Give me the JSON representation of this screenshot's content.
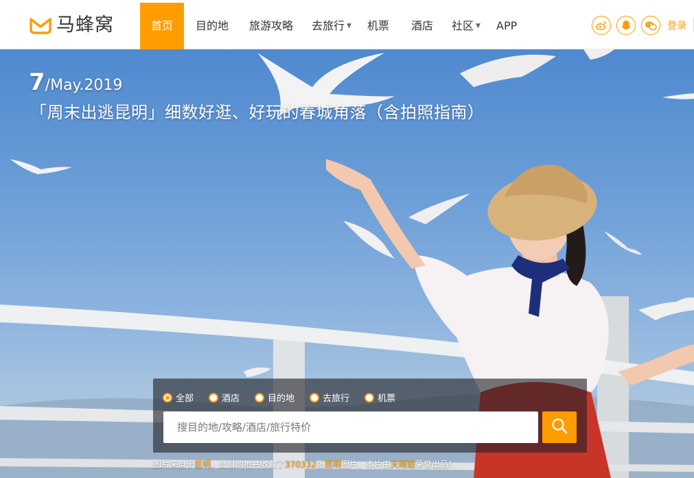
{
  "brand": {
    "name": "马蜂窝"
  },
  "nav": [
    {
      "label": "首页",
      "active": true
    },
    {
      "label": "目的地"
    },
    {
      "label": "旅游攻略"
    },
    {
      "label": "去旅行",
      "dropdown": true
    },
    {
      "label": "机票"
    },
    {
      "label": "酒店"
    },
    {
      "label": "社区",
      "dropdown": true
    },
    {
      "label": "APP"
    }
  ],
  "header_right": {
    "social_icons": [
      "weibo-icon",
      "qq-icon",
      "wechat-icon"
    ],
    "login": "登录"
  },
  "hero": {
    "day": "7",
    "date_rest": "/May.2019",
    "title": "「周末出逃昆明」细数好逛、好玩的春城角落（含拍照指南）"
  },
  "search": {
    "options": [
      {
        "label": "全部",
        "checked": true
      },
      {
        "label": "酒店"
      },
      {
        "label": "目的地"
      },
      {
        "label": "去旅行"
      },
      {
        "label": "机票"
      }
    ],
    "placeholder": "搜目的地/攻略/酒店/旅行特价",
    "button_icon": "search-icon"
  },
  "credit": {
    "prefix": "图片来自于",
    "place": "昆明",
    "middle": "，此目的地共收藏了",
    "count": "370332",
    "unit": "张",
    "place2": "昆明",
    "middle2": "图片。本片由",
    "author": "天晴姐",
    "suffix": "荣誉出品！"
  },
  "colors": {
    "accent": "#ff9d00",
    "header_bg": "#ffffff",
    "sky": "#5f95d4"
  }
}
